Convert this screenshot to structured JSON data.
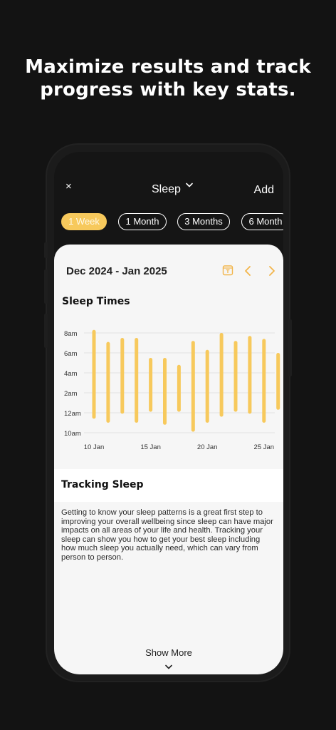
{
  "headline": "Maximize results and track progress with key stats.",
  "header": {
    "close_icon": "×",
    "title": "Sleep",
    "add_label": "Add"
  },
  "tabs": [
    {
      "label": "1 Week",
      "active": true
    },
    {
      "label": "1 Month",
      "active": false
    },
    {
      "label": "3 Months",
      "active": false
    },
    {
      "label": "6 Month",
      "active": false
    }
  ],
  "card": {
    "date_range": "Dec 2024 - Jan 2025",
    "icons": {
      "calendar": "calendar-icon",
      "prev": "chevron-left-icon",
      "next": "chevron-right-icon"
    },
    "accent_color": "#f7c95c",
    "section_title": "Sleep Times",
    "tracking_title": "Tracking Sleep",
    "tracking_text": "Getting to know your sleep patterns is a great first step to improving your overall wellbeing since sleep can have major impacts on all areas of your life and health. Tracking your sleep can show you how to get your best sleep including how much sleep you actually need, which can vary from person to person.",
    "show_more": "Show More"
  },
  "chart_data": {
    "type": "bar",
    "title": "Sleep Times",
    "y_tick_labels": [
      "8am",
      "6am",
      "4am",
      "2am",
      "12am",
      "10am"
    ],
    "x_tick_labels": [
      "10 Jan",
      "15 Jan",
      "20 Jan",
      "25 Jan"
    ],
    "y_axis": "hours after 10pm (10pm = 0, 8am = 10)",
    "grid": true,
    "color": "#f7c95c",
    "series": [
      {
        "bars": [
          {
            "start": 1.4,
            "end": 10.3
          },
          {
            "start": 1.0,
            "end": 9.1
          },
          {
            "start": 1.9,
            "end": 9.5
          },
          {
            "start": 1.0,
            "end": 9.5
          },
          {
            "start": 2.1,
            "end": 7.5
          },
          {
            "start": 0.8,
            "end": 7.5
          },
          {
            "start": 2.1,
            "end": 6.8
          },
          {
            "start": 0.1,
            "end": 9.2
          },
          {
            "start": 1.0,
            "end": 8.3
          },
          {
            "start": 1.6,
            "end": 10.0
          },
          {
            "start": 2.1,
            "end": 9.2
          },
          {
            "start": 1.9,
            "end": 9.7
          },
          {
            "start": 1.0,
            "end": 9.4
          },
          {
            "start": 2.3,
            "end": 8.0
          }
        ]
      }
    ]
  }
}
